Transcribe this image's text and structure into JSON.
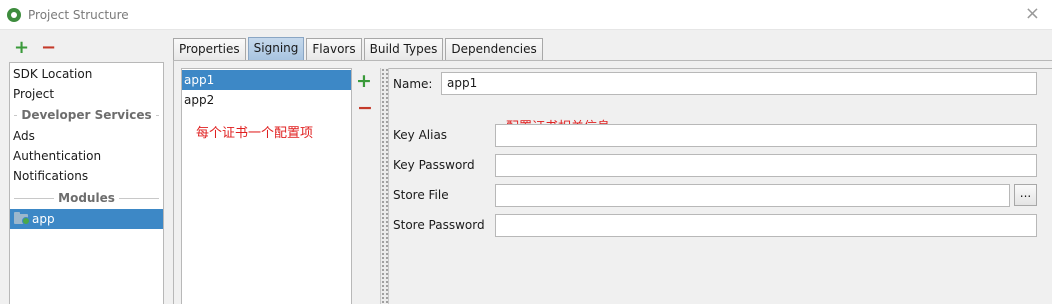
{
  "window": {
    "title": "Project Structure"
  },
  "left_toolbar": {
    "add": "+",
    "remove": "−"
  },
  "nav": {
    "top_items": [
      "SDK Location",
      "Project"
    ],
    "developer_services_header": "Developer Services",
    "developer_services_items": [
      "Ads",
      "Authentication",
      "Notifications"
    ],
    "modules_header": "Modules",
    "modules_items": [
      "app"
    ]
  },
  "tabs": [
    {
      "label": "Properties",
      "active": false
    },
    {
      "label": "Signing",
      "active": true
    },
    {
      "label": "Flavors",
      "active": false
    },
    {
      "label": "Build Types",
      "active": false
    },
    {
      "label": "Dependencies",
      "active": false
    }
  ],
  "signing_list": {
    "items": [
      "app1",
      "app2"
    ],
    "selected_index": 0,
    "add": "+",
    "remove": "−",
    "annotation": "每个证书一个配置项"
  },
  "form": {
    "name_label": "Name:",
    "name_value": "app1",
    "annotation": "配置证书相关信息",
    "key_alias_label": "Key Alias",
    "key_alias_value": "",
    "key_password_label": "Key Password",
    "key_password_value": "",
    "store_file_label": "Store File",
    "store_file_value": "",
    "browse_label": "...",
    "store_password_label": "Store Password",
    "store_password_value": ""
  },
  "colors": {
    "selection": "#3d88c6",
    "annotation_red": "#e02020",
    "add_green": "#3a9a3a",
    "remove_red": "#c43a2a"
  }
}
